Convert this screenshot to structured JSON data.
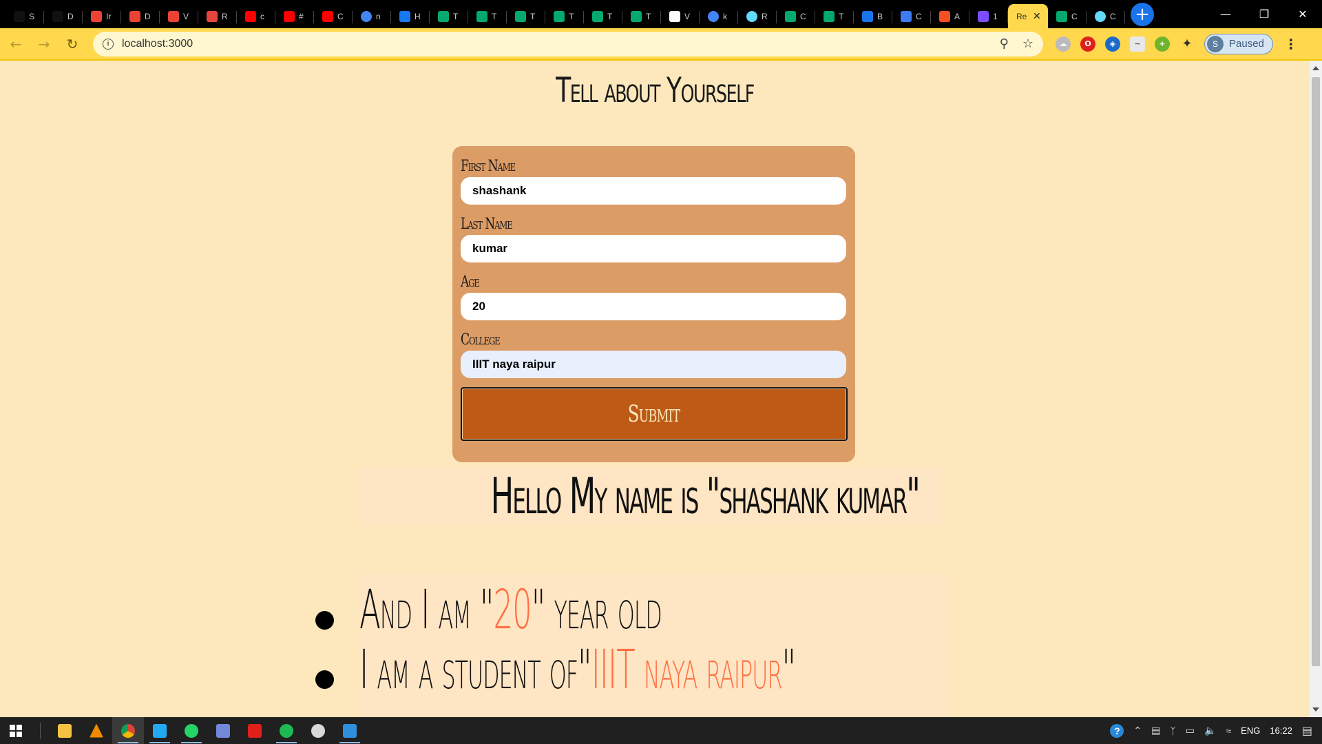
{
  "browser": {
    "tabs": [
      {
        "title": "S",
        "icon": "nh-icon",
        "color": "#111111"
      },
      {
        "title": "D",
        "icon": "nh-icon",
        "color": "#111111"
      },
      {
        "title": "Ir",
        "icon": "gmail-icon",
        "color": "#ea4335"
      },
      {
        "title": "D",
        "icon": "gmail-icon",
        "color": "#ea4335"
      },
      {
        "title": "V",
        "icon": "gmail-icon",
        "color": "#ea4335"
      },
      {
        "title": "R",
        "icon": "arrow-icon",
        "color": "#e4463c"
      },
      {
        "title": "c",
        "icon": "youtube-icon",
        "color": "#ff0000"
      },
      {
        "title": "#",
        "icon": "youtube-icon",
        "color": "#ff0000"
      },
      {
        "title": "C",
        "icon": "youtube-icon",
        "color": "#ff0000"
      },
      {
        "title": "n",
        "icon": "google-icon",
        "color": "#4285f4"
      },
      {
        "title": "H",
        "icon": "messenger-icon",
        "color": "#1877f2"
      },
      {
        "title": "T",
        "icon": "w3-icon",
        "color": "#04aa6d"
      },
      {
        "title": "T",
        "icon": "w3-icon",
        "color": "#04aa6d"
      },
      {
        "title": "T",
        "icon": "w3-icon",
        "color": "#04aa6d"
      },
      {
        "title": "T",
        "icon": "w3-icon",
        "color": "#04aa6d"
      },
      {
        "title": "T",
        "icon": "w3-icon",
        "color": "#04aa6d"
      },
      {
        "title": "T",
        "icon": "w3-icon",
        "color": "#04aa6d"
      },
      {
        "title": "V",
        "icon": "medium-icon",
        "color": "#ffffff"
      },
      {
        "title": "k",
        "icon": "google-icon",
        "color": "#4285f4"
      },
      {
        "title": "R",
        "icon": "react-icon",
        "color": "#61dafb"
      },
      {
        "title": "C",
        "icon": "w3-icon",
        "color": "#04aa6d"
      },
      {
        "title": "T",
        "icon": "w3-icon",
        "color": "#04aa6d"
      },
      {
        "title": "B",
        "icon": "f-icon",
        "color": "#1a73e8"
      },
      {
        "title": "C",
        "icon": "p-icon",
        "color": "#3d7cf0"
      },
      {
        "title": "A",
        "icon": "microsoft-icon",
        "color": "#f25022"
      },
      {
        "title": "1",
        "icon": "play-icon",
        "color": "#7c4dff"
      },
      {
        "title": "Re",
        "icon": "",
        "color": "#ffd84d",
        "active": true
      },
      {
        "title": "C",
        "icon": "w3-icon",
        "color": "#04aa6d"
      },
      {
        "title": "C",
        "icon": "react-icon",
        "color": "#61dafb"
      }
    ],
    "url": "localhost:3000",
    "profile_initial": "S",
    "profile_status": "Paused",
    "accent": "#ffd84d"
  },
  "page": {
    "heading": "Tell about Yourself",
    "form": {
      "first_name_label": "First Name",
      "first_name_value": "shashank",
      "last_name_label": "Last Name",
      "last_name_value": "kumar",
      "age_label": "Age",
      "age_value": "20",
      "college_label": "College",
      "college_value": "IIIT naya raipur",
      "submit_label": "Submit"
    },
    "hello": "Hello My name is \"shashank kumar\"",
    "list": {
      "age_prefix": "And I am \"",
      "age_value": "20",
      "age_suffix": "\" year old",
      "college_prefix": "I am a student of\"",
      "college_value": "IIIT naya raipur",
      "college_suffix": "\""
    },
    "colors": {
      "background": "#fde8bd",
      "card": "#dc9c66",
      "button": "#bd5a16",
      "highlight": "#ff7043"
    }
  },
  "taskbar": {
    "language": "ENG",
    "time": "16:22"
  }
}
